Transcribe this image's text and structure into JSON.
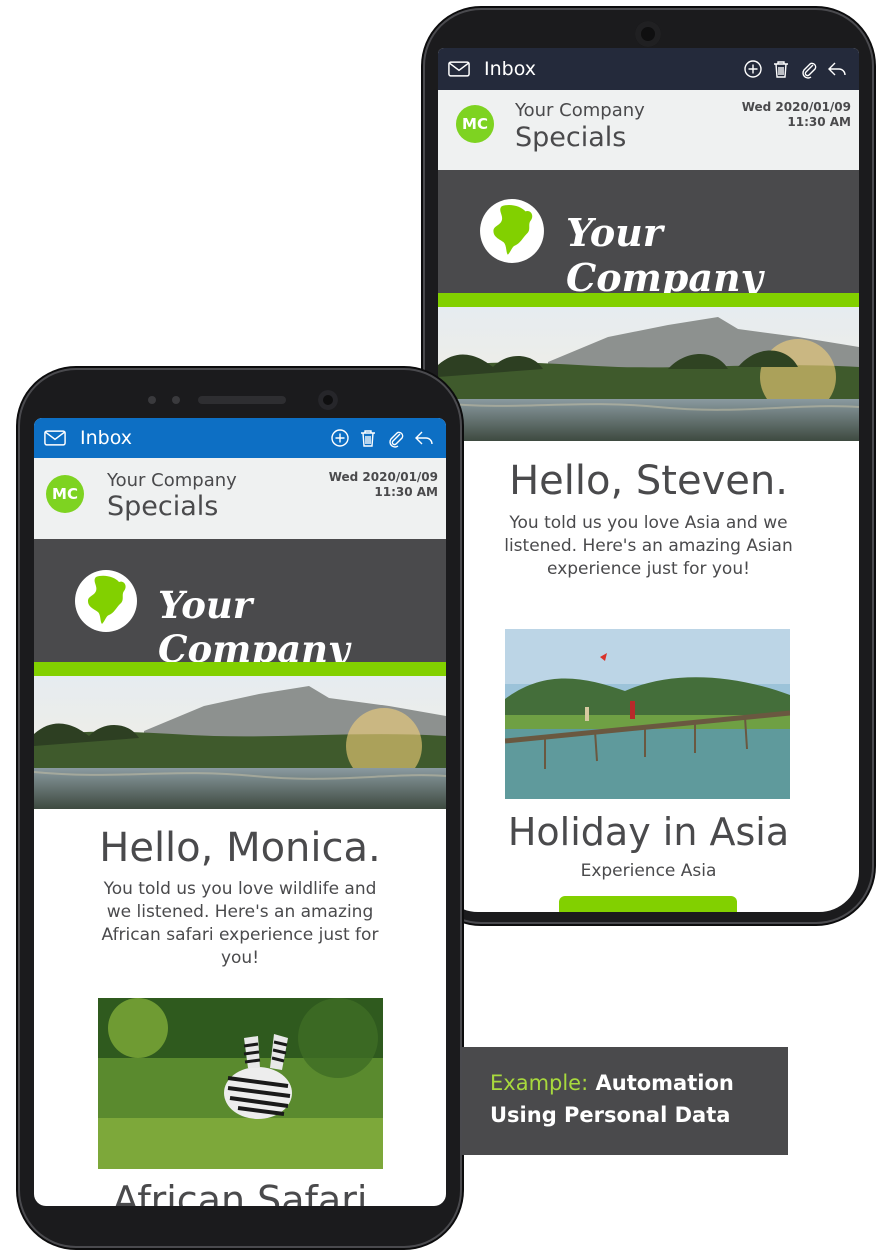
{
  "inbox_label": "Inbox",
  "colors": {
    "topbar_back": "#242a3b",
    "topbar_front": "#0d6fc4",
    "brand_bg": "#4a4a4c",
    "accent_green": "#82d000",
    "avatar": "#7ed321"
  },
  "email": {
    "avatar_initials": "MC",
    "sender": "Your Company",
    "subject": "Specials",
    "date_line1": "Wed 2020/01/09",
    "date_line2": "11:30 AM",
    "brand": "Your Company"
  },
  "back_phone": {
    "greeting": "Hello, Steven.",
    "intro": "You told us you love Asia and we listened. Here's an amazing Asian experience just for you!",
    "offer_title": "Holiday in Asia",
    "offer_subtitle": "Experience Asia"
  },
  "front_phone": {
    "greeting": "Hello, Monica.",
    "intro": "You told us you love wildlife and we listened. Here's an amazing African safari experience just for you!",
    "offer_title": "African Safari"
  },
  "caption": {
    "accent": "Example:",
    "line1_rest": "Automation",
    "line2": "Using Personal Data"
  },
  "icons": [
    "envelope-icon",
    "add-icon",
    "trash-icon",
    "attachment-icon",
    "reply-icon",
    "globe-icon"
  ]
}
